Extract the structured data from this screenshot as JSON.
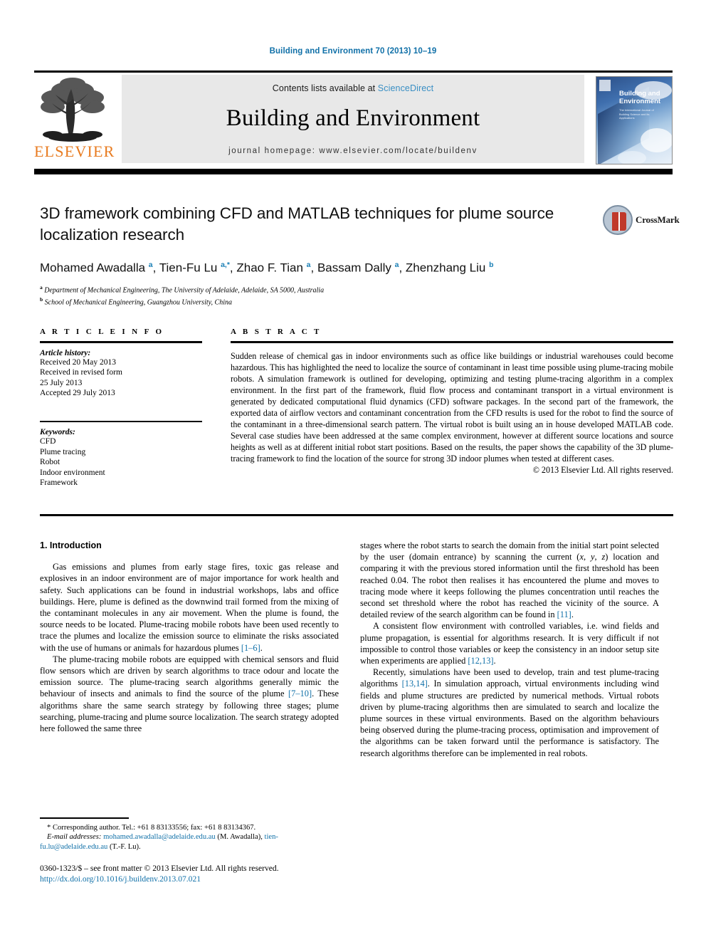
{
  "running_head": "Building and Environment 70 (2013) 10–19",
  "masthead": {
    "publisher": "ELSEVIER",
    "contents_prefix": "Contents lists available at ",
    "sciencedirect": "ScienceDirect",
    "journal_name": "Building and Environment",
    "homepage": "journal homepage: www.elsevier.com/locate/buildenv",
    "cover_title_line1": "Building and",
    "cover_title_line2": "Environment",
    "cover_subtitle": "The International Journal of Building Science and its Applications"
  },
  "article": {
    "title": "3D framework combining CFD and MATLAB techniques for plume source localization research",
    "authors_html": "Mohamed Awadalla <sup>a</sup>, Tien-Fu Lu <sup>a,*</sup>, Zhao F. Tian <sup>a</sup>, Bassam Dally <sup>a</sup>, Zhenzhang Liu <sup>b</sup>",
    "affiliation_a": "Department of Mechanical Engineering, The University of Adelaide, Adelaide, SA 5000, Australia",
    "affiliation_b": "School of Mechanical Engineering, Guangzhou University, China",
    "crossmark_label": "CrossMark"
  },
  "info": {
    "heading": "A R T I C L E   I N F O",
    "history_label": "Article history:",
    "history_lines": [
      "Received 20 May 2013",
      "Received in revised form",
      "25 July 2013",
      "Accepted 29 July 2013"
    ],
    "keywords_label": "Keywords:",
    "keywords": [
      "CFD",
      "Plume tracing",
      "Robot",
      "Indoor environment",
      "Framework"
    ]
  },
  "abstract": {
    "heading": "A B S T R A C T",
    "text": "Sudden release of chemical gas in indoor environments such as office like buildings or industrial warehouses could become hazardous. This has highlighted the need to localize the source of contaminant in least time possible using plume-tracing mobile robots. A simulation framework is outlined for developing, optimizing and testing plume-tracing algorithm in a complex environment. In the first part of the framework, fluid flow process and contaminant transport in a virtual environment is generated by dedicated computational fluid dynamics (CFD) software packages. In the second part of the framework, the exported data of airflow vectors and contaminant concentration from the CFD results is used for the robot to find the source of the contaminant in a three-dimensional search pattern. The virtual robot is built using an in house developed MATLAB code. Several case studies have been addressed at the same complex environment, however at different source locations and source heights as well as at different initial robot start positions. Based on the results, the paper shows the capability of the 3D plume-tracing framework to find the location of the source for strong 3D indoor plumes when tested at different cases.",
    "copyright": "© 2013 Elsevier Ltd. All rights reserved."
  },
  "body": {
    "section_number_title": "1. Introduction",
    "left_paragraphs_html": [
      "Gas emissions and plumes from early stage fires, toxic gas release and explosives in an indoor environment are of major importance for work health and safety. Such applications can be found in industrial workshops, labs and office buildings. Here, plume is defined as the downwind trail formed from the mixing of the contaminant molecules in any air movement. When the plume is found, the source needs to be located. Plume-tracing mobile robots have been used recently to trace the plumes and localize the emission source to eliminate the risks associated with the use of humans or animals for hazardous plumes <span class=\"ref\">[1–6]</span>.",
      "The plume-tracing mobile robots are equipped with chemical sensors and fluid flow sensors which are driven by search algorithms to trace odour and locate the emission source. The plume-tracing search algorithms generally mimic the behaviour of insects and animals to find the source of the plume <span class=\"ref\">[7–10]</span>. These algorithms share the same search strategy by following three stages; plume searching, plume-tracing and plume source localization. The search strategy adopted here followed the same three"
    ],
    "right_paragraphs_html": [
      "stages where the robot starts to search the domain from the initial start point selected by the user (domain entrance) by scanning the current (<i>x</i>, <i>y</i>, <i>z</i>) location and comparing it with the previous stored information until the first threshold has been reached 0.04. The robot then realises it has encountered the plume and moves to tracing mode where it keeps following the plumes concentration until reaches the second set threshold where the robot has reached the vicinity of the source. A detailed review of the search algorithm can be found in <span class=\"ref\">[11]</span>.",
      "A consistent flow environment with controlled variables, i.e. wind fields and plume propagation, is essential for algorithms research. It is very difficult if not impossible to control those variables or keep the consistency in an indoor setup site when experiments are applied <span class=\"ref\">[12,13]</span>.",
      "Recently, simulations have been used to develop, train and test plume-tracing algorithms <span class=\"ref\">[13,14]</span>. In simulation approach, virtual environments including wind fields and plume structures are predicted by numerical methods. Virtual robots driven by plume-tracing algorithms then are simulated to search and localize the plume sources in these virtual environments. Based on the algorithm behaviours being observed during the plume-tracing process, optimisation and improvement of the algorithms can be taken forward until the performance is satisfactory. The research algorithms therefore can be implemented in real robots."
    ]
  },
  "footnote": {
    "corresponding_html": "* Corresponding author. Tel.: +61 8 83133556; fax: +61 8 83134367.",
    "email_html": "<span class=\"em-label\">E-mail addresses:</span> <span class=\"email-link\">mohamed.awadalla@adelaide.edu.au</span> (M. Awadalla), <span class=\"email-link\">tien-fu.lu@adelaide.edu.au</span> (T.-F. Lu)."
  },
  "imprint": {
    "line1": "0360-1323/$ – see front matter © 2013 Elsevier Ltd. All rights reserved.",
    "doi": "http://dx.doi.org/10.1016/j.buildenv.2013.07.021"
  },
  "colors": {
    "link_blue": "#1070a8",
    "sciencedirect_blue": "#3a8fc4",
    "elsevier_orange": "#E87B20",
    "band_gray": "#e8e8e8"
  }
}
